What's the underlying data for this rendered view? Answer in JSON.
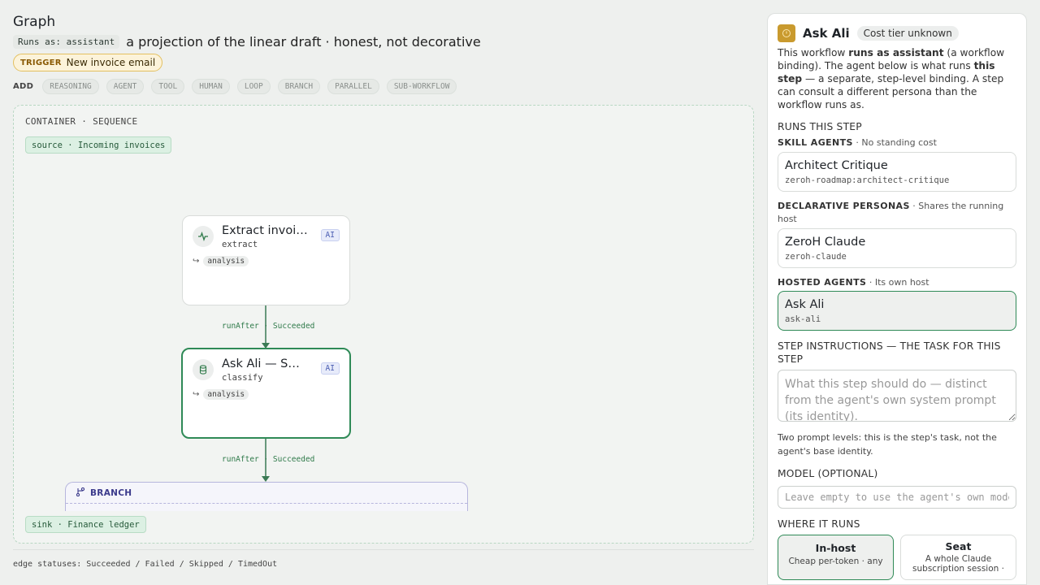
{
  "graph": {
    "title": "Graph",
    "runs_as": "Runs as: assistant",
    "description": "a projection of the linear draft · honest, not decorative",
    "trigger": {
      "tag": "TRIGGER",
      "value": "New invoice email"
    },
    "add": {
      "label": "ADD",
      "items": [
        "REASONING",
        "AGENT",
        "TOOL",
        "HUMAN",
        "LOOP",
        "BRANCH",
        "PARALLEL",
        "SUB-WORKFLOW"
      ]
    },
    "container": {
      "title": "CONTAINER · SEQUENCE",
      "source": "source · Incoming invoices",
      "sink": "sink · Finance ledger"
    },
    "nodes": [
      {
        "name": "Extract invoice fields",
        "kind": "extract",
        "badge": "AI",
        "annotation": "analysis",
        "icon": "activity-icon",
        "selected": false
      },
      {
        "name": "Ask Ali — Shortlist",
        "kind": "classify",
        "badge": "AI",
        "annotation": "analysis",
        "icon": "database-icon",
        "selected": true
      }
    ],
    "edges": [
      {
        "label": "runAfter · Succeeded"
      },
      {
        "label": "runAfter · Succeeded"
      }
    ],
    "branch": {
      "label": "BRANCH"
    },
    "footer": "edge statuses: Succeeded / Failed / Skipped / TimedOut"
  },
  "panel": {
    "name": "Ask Ali",
    "cost": "Cost tier unknown",
    "intro": {
      "t1": "This workflow ",
      "b1": "runs as assistant",
      "t2": " (a workflow binding). The agent below is what runs ",
      "b2": "this step",
      "t3": " — a separate, step-level binding. A step can consult a different persona than the workflow runs as."
    },
    "runs_this_step": "RUNS THIS STEP",
    "skill_agents": {
      "label": "SKILL AGENTS",
      "note": " · No standing cost",
      "items": [
        {
          "name": "Architect Critique",
          "id": "zeroh-roadmap:architect-critique"
        }
      ]
    },
    "declarative_personas": {
      "label": "DECLARATIVE PERSONAS",
      "note": " · Shares the running host",
      "items": [
        {
          "name": "ZeroH Claude",
          "id": "zeroh-claude"
        }
      ]
    },
    "hosted_agents": {
      "label": "HOSTED AGENTS",
      "note": " · Its own host",
      "items": [
        {
          "name": "Ask Ali",
          "id": "ask-ali",
          "selected": true
        }
      ]
    },
    "instructions": {
      "label": "STEP INSTRUCTIONS — THE TASK FOR THIS STEP",
      "value": "",
      "placeholder": "What this step should do — distinct from the agent's own system prompt (its identity)."
    },
    "hint": "Two prompt levels: this is the step's task, not the agent's base identity.",
    "model": {
      "label": "MODEL (OPTIONAL)",
      "value": "",
      "placeholder": "Leave empty to use the agent's own model"
    },
    "where": {
      "label": "WHERE IT RUNS",
      "options": [
        {
          "title": "In-host",
          "desc": "Cheap per-token · any",
          "selected": true
        },
        {
          "title": "Seat",
          "desc": "A whole Claude subscription session ·",
          "selected": false
        }
      ]
    }
  },
  "colors": {
    "accent": "#2f8a57",
    "edge": "#3b7a55",
    "trigger_bg": "#fcf3da",
    "ai_badge": "#4a5db2",
    "branch": "#3c3b8c",
    "avatar": "#c99a2e"
  }
}
